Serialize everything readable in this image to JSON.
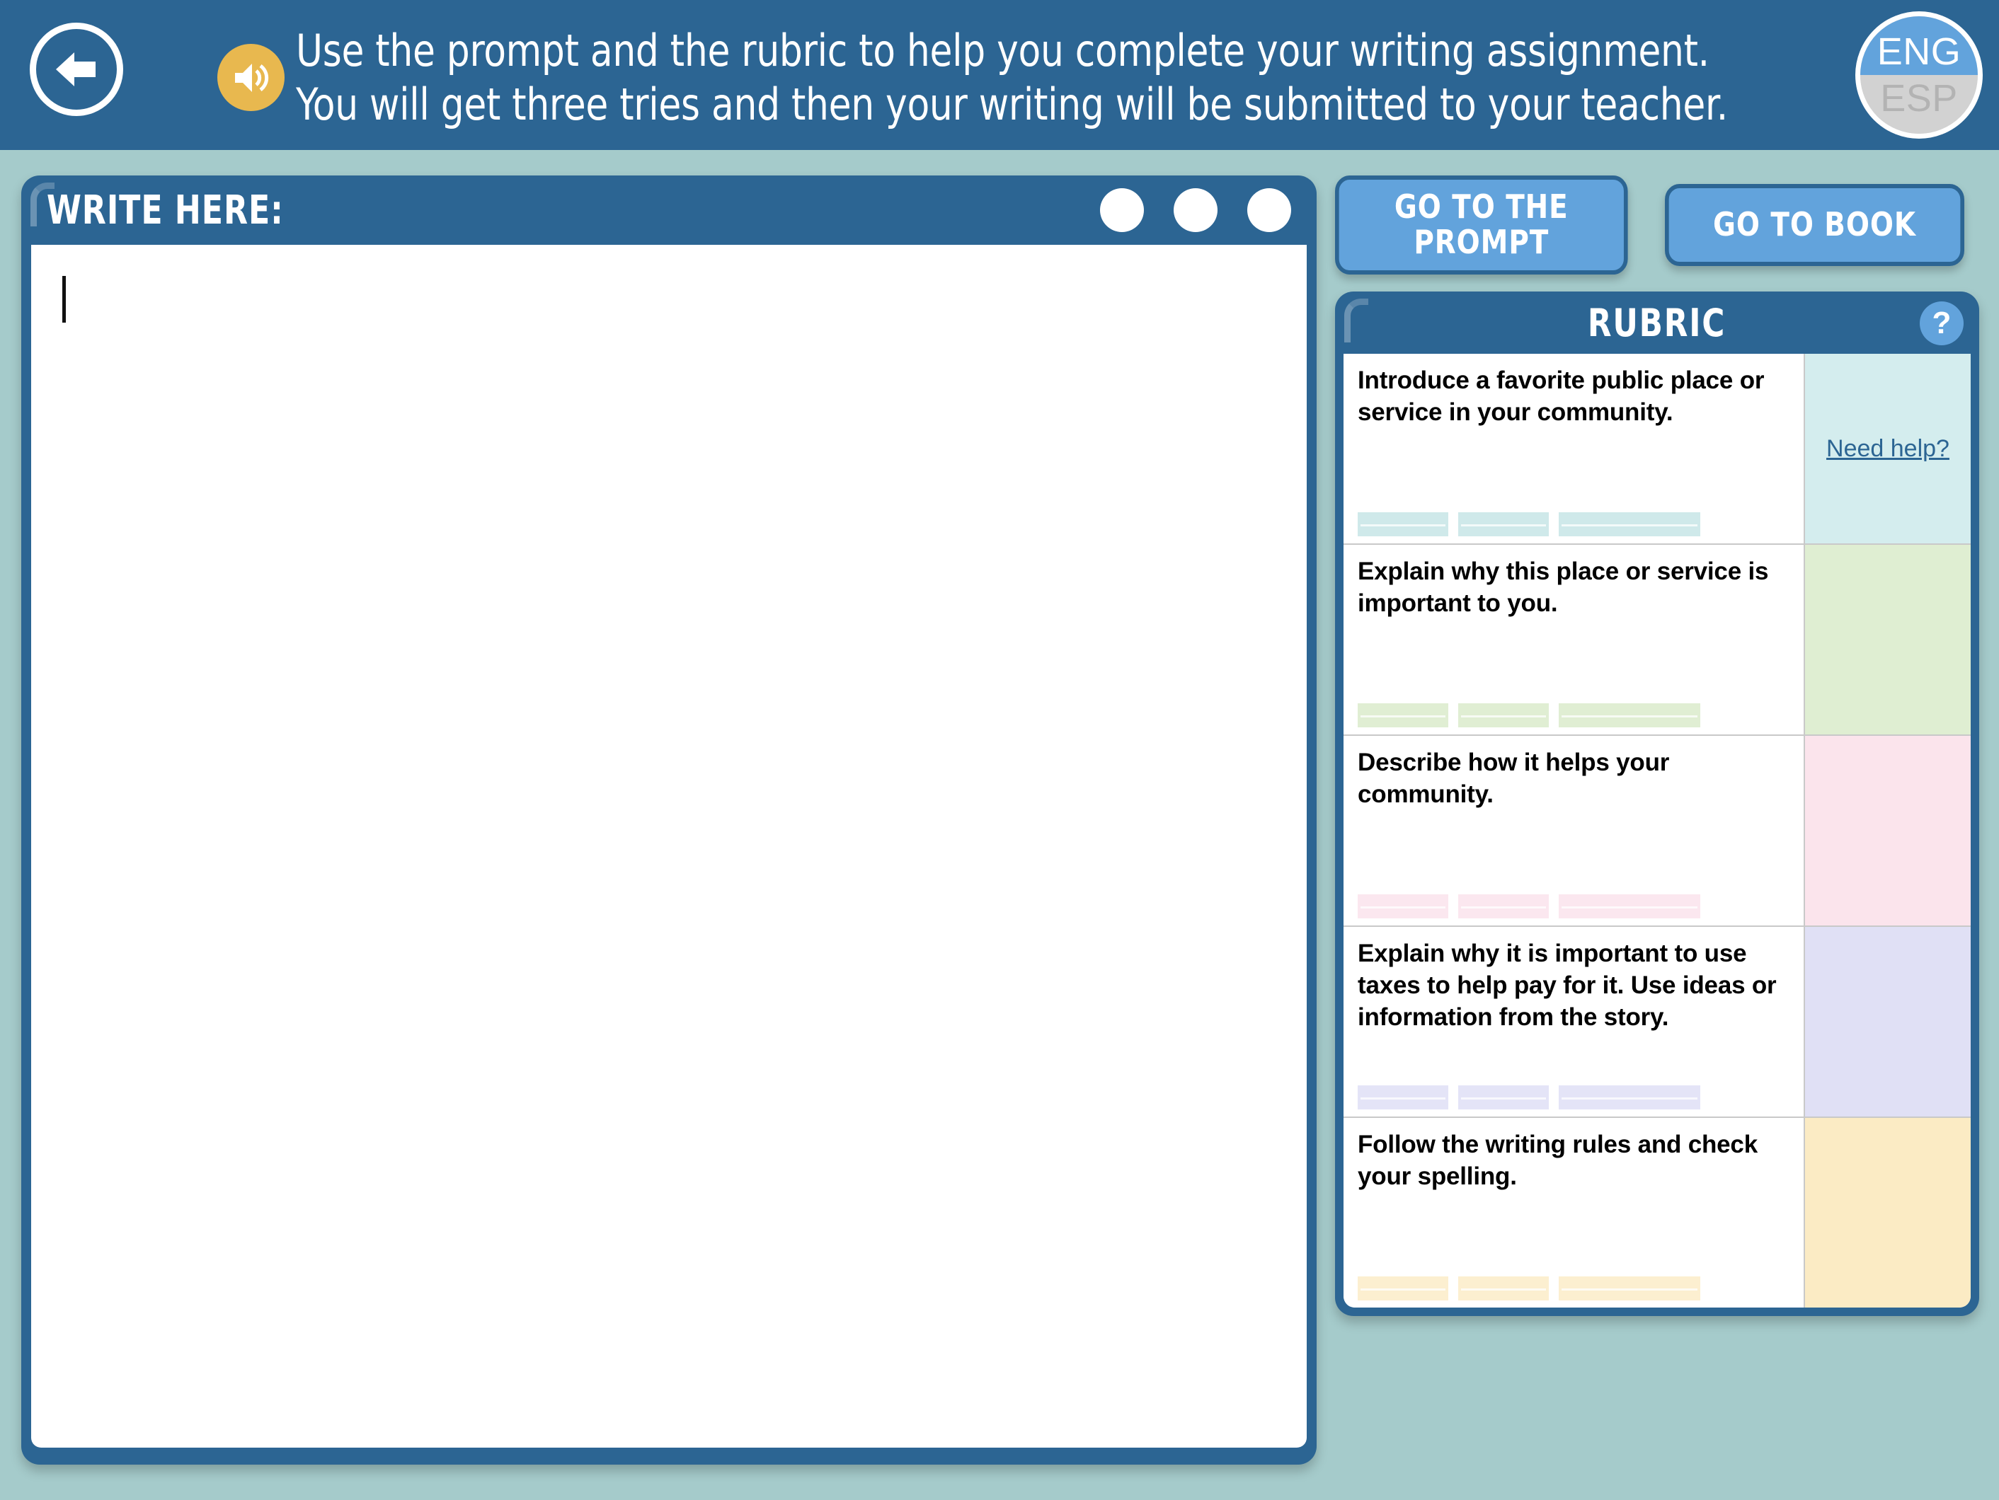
{
  "header": {
    "back_icon": "back-arrow-icon",
    "audio_icon": "speaker-icon",
    "instruction_line1": "Use the prompt and the rubric to help you complete your writing assignment.",
    "instruction_line2": "You will get three tries and then your writing will be submitted to your teacher.",
    "language_toggle": {
      "active": "ENG",
      "inactive": "ESP"
    },
    "bg_color": "#2c6593"
  },
  "write_panel": {
    "title": "WRITE HERE:",
    "tries_total": 3,
    "text_value": "",
    "caret_visible": true
  },
  "nav": {
    "go_to_prompt": "GO TO THE PROMPT",
    "go_to_book": "GO TO BOOK",
    "button_color": "#62a3dc"
  },
  "rubric": {
    "title": "RUBRIC",
    "help_icon": "question-mark-icon",
    "help_label": "?",
    "need_help_label": "Need help?",
    "rows": [
      {
        "criterion": "Introduce a favorite public place or service in your community.",
        "color": "#d4edee",
        "bar_color": "#cfe9ea",
        "side_label": "Need help?",
        "has_link": true
      },
      {
        "criterion": "Explain why this place or service is important to you.",
        "color": "#dfeed2",
        "bar_color": "#e0eed3",
        "side_label": "",
        "has_link": false
      },
      {
        "criterion": "Describe how it helps your community.",
        "color": "#fbe4ec",
        "bar_color": "#fbe7ef",
        "side_label": "",
        "has_link": false
      },
      {
        "criterion": "Explain why it is important to use taxes to help pay for it. Use ideas or information from the story.",
        "color": "#e0e0f5",
        "bar_color": "#e4e4f7",
        "side_label": "",
        "has_link": false
      },
      {
        "criterion": "Follow the writing rules and check your spelling.",
        "color": "#fbebc4",
        "bar_color": "#fcefd0",
        "side_label": "",
        "has_link": false
      }
    ]
  },
  "page": {
    "background_color": "#a5cbcb",
    "panel_color": "#2c6593"
  }
}
